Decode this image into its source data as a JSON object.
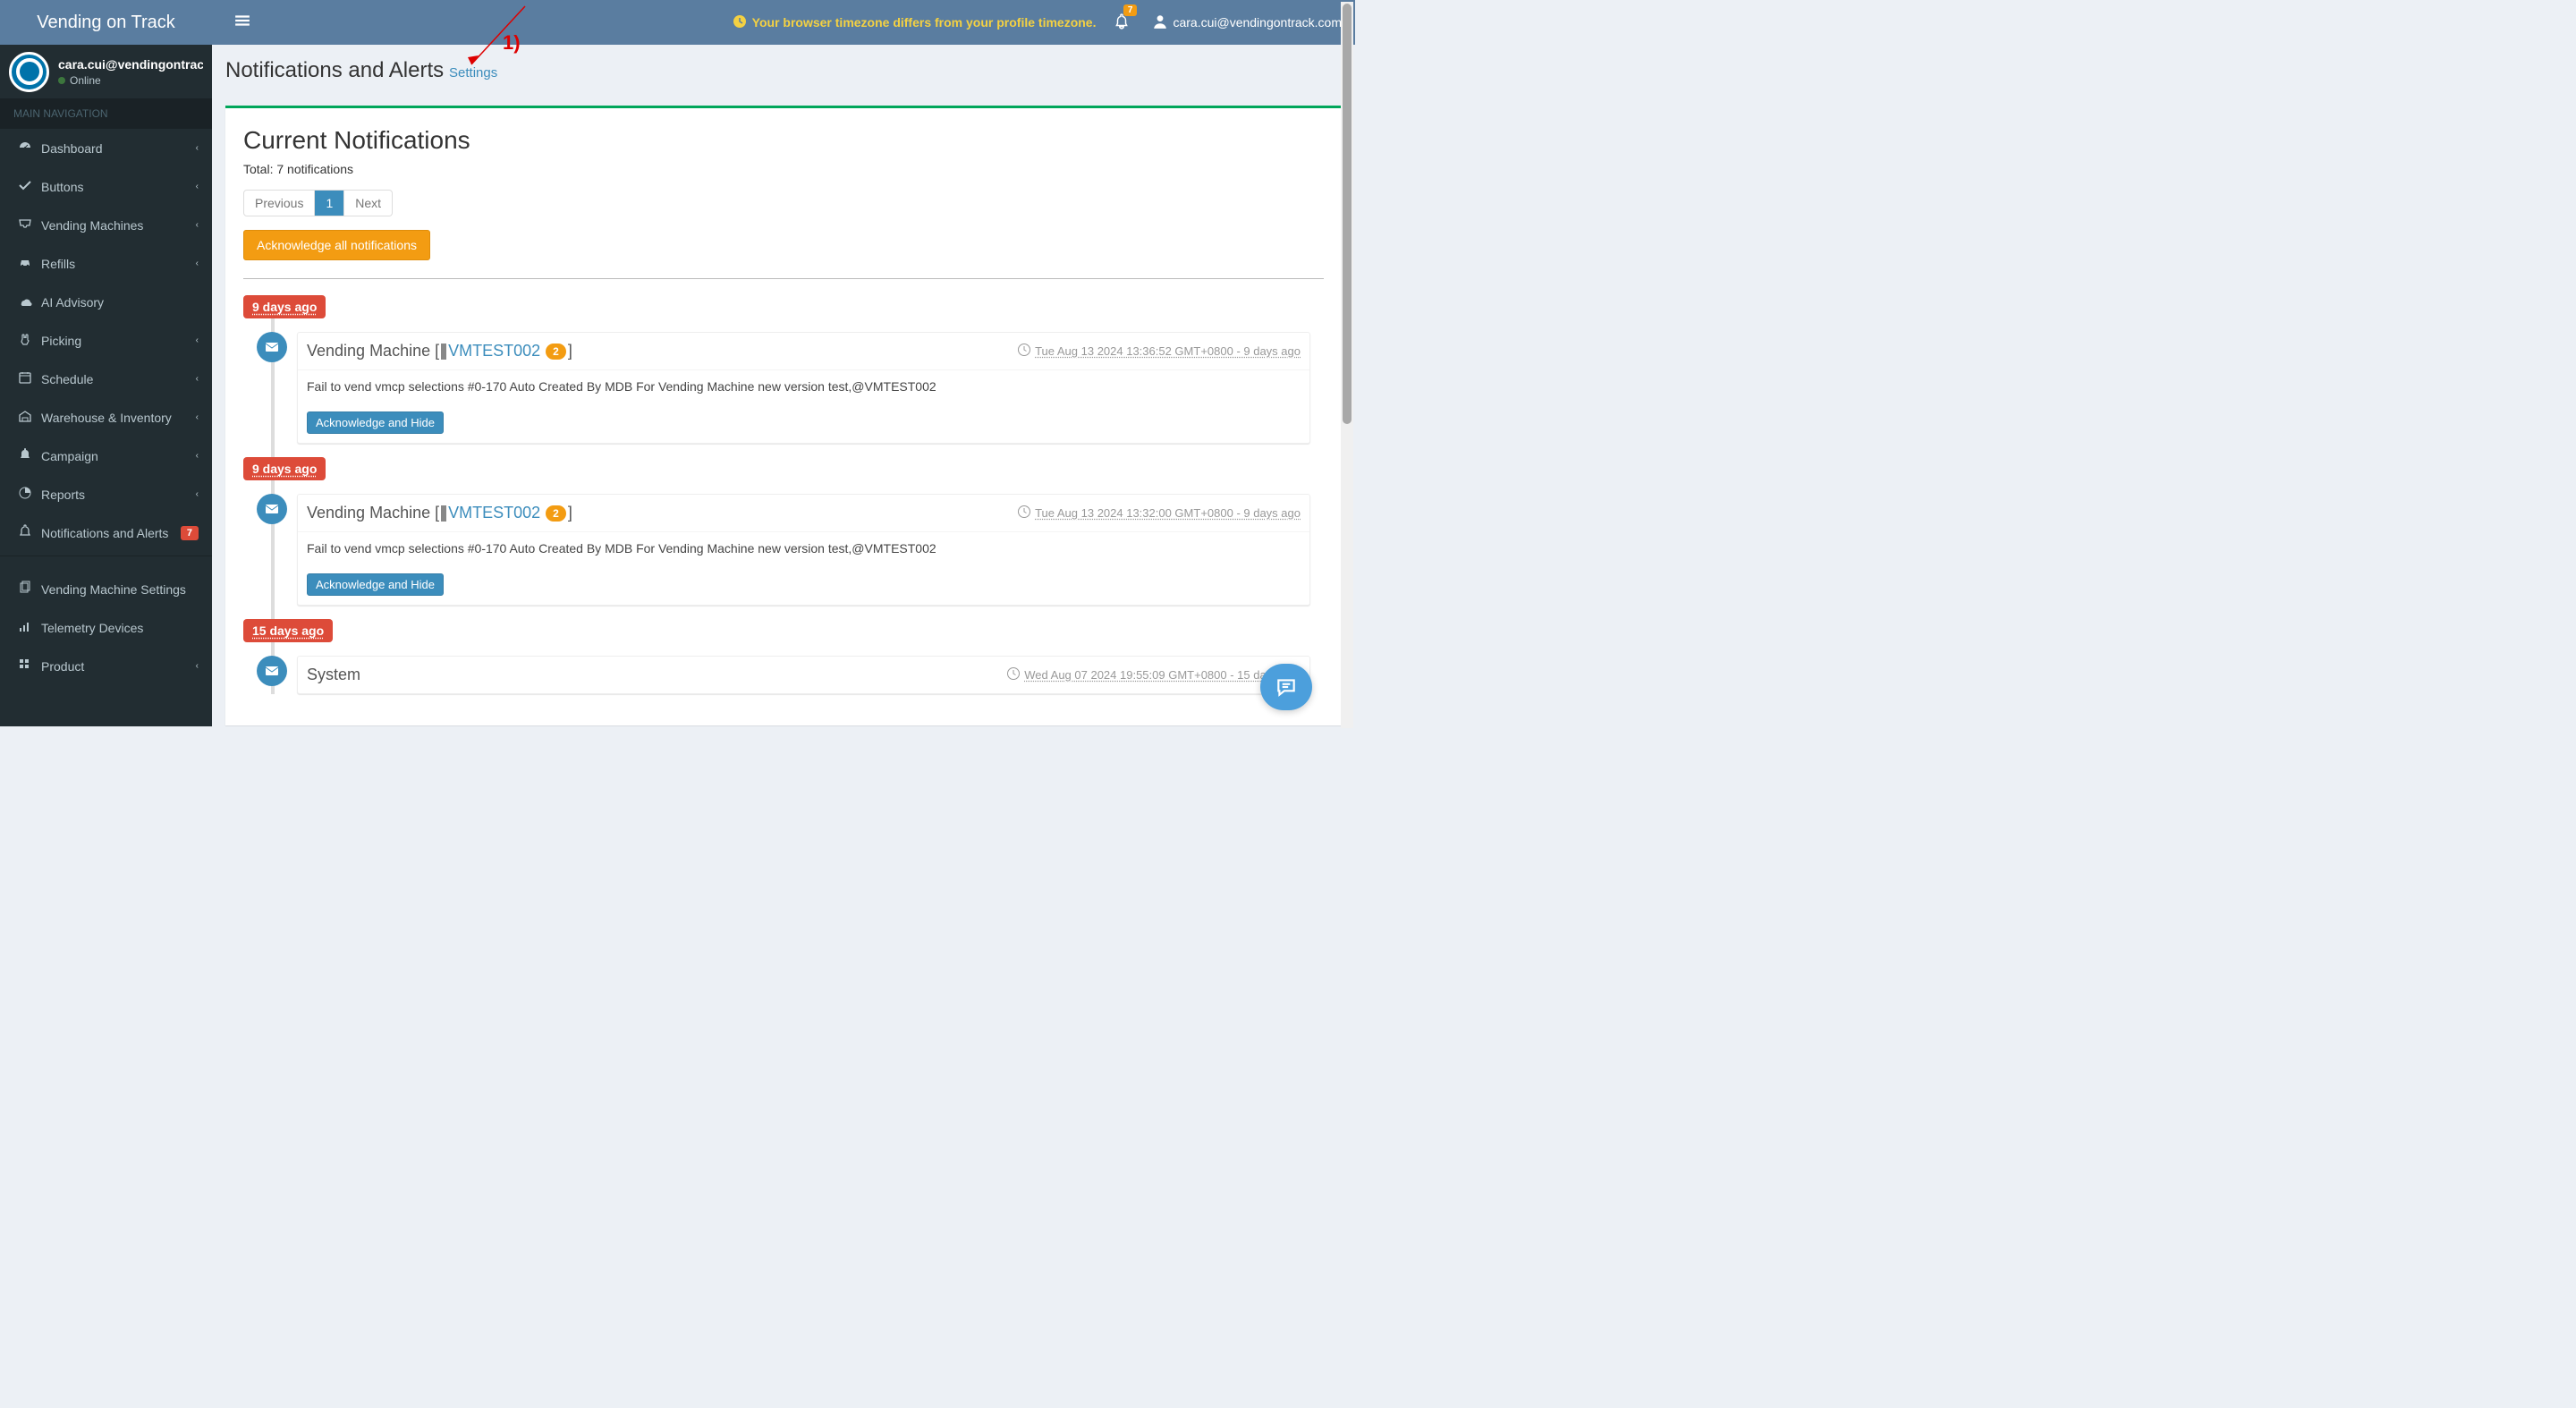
{
  "brand": "Vending on Track",
  "header": {
    "tz_warning": "Your browser timezone differs from your profile timezone.",
    "bell_badge": "7",
    "user_email": "cara.cui@vendingontrack.com"
  },
  "sidebar": {
    "user_email": "cara.cui@vendingontrack.c",
    "user_status": "Online",
    "nav_header": "MAIN NAVIGATION",
    "items": [
      {
        "label": "Dashboard",
        "icon": "dashboard",
        "chevron": true
      },
      {
        "label": "Buttons",
        "icon": "check",
        "chevron": true
      },
      {
        "label": "Vending Machines",
        "icon": "inbox",
        "chevron": true
      },
      {
        "label": "Refills",
        "icon": "car",
        "chevron": true
      },
      {
        "label": "AI Advisory",
        "icon": "cloud",
        "chevron": false
      },
      {
        "label": "Picking",
        "icon": "hand",
        "chevron": true
      },
      {
        "label": "Schedule",
        "icon": "calendar",
        "chevron": true
      },
      {
        "label": "Warehouse & Inventory",
        "icon": "warehouse",
        "chevron": true
      },
      {
        "label": "Campaign",
        "icon": "bell-fill",
        "chevron": true
      },
      {
        "label": "Reports",
        "icon": "pie",
        "chevron": true
      },
      {
        "label": "Notifications and Alerts",
        "icon": "bell",
        "chevron": false,
        "badge": "7"
      }
    ],
    "items2": [
      {
        "label": "Vending Machine Settings",
        "icon": "copy",
        "chevron": false
      },
      {
        "label": "Telemetry Devices",
        "icon": "signal",
        "chevron": false
      },
      {
        "label": "Product",
        "icon": "grid",
        "chevron": true
      }
    ]
  },
  "page": {
    "title": "Notifications and Alerts",
    "settings_link": "Settings",
    "annotation": "1)"
  },
  "main": {
    "heading": "Current Notifications",
    "total_prefix": "Total: ",
    "total_count": "7",
    "total_suffix": " notifications",
    "pagination": {
      "prev": "Previous",
      "page": "1",
      "next": "Next"
    },
    "ack_all": "Acknowledge all notifications",
    "ack_hide": "Acknowledge and Hide",
    "entries": [
      {
        "age": "9 days ago",
        "title_prefix": "Vending Machine [",
        "vm": "VMTEST002",
        "count": "2",
        "title_suffix": "]",
        "timestamp": "Tue Aug 13 2024 13:36:52 GMT+0800 - 9 days ago",
        "body": "Fail to vend vmcp selections #0-170 Auto Created By MDB For Vending Machine new version test,@VMTEST002"
      },
      {
        "age": "9 days ago",
        "title_prefix": "Vending Machine [",
        "vm": "VMTEST002",
        "count": "2",
        "title_suffix": "]",
        "timestamp": "Tue Aug 13 2024 13:32:00 GMT+0800 - 9 days ago",
        "body": "Fail to vend vmcp selections #0-170 Auto Created By MDB For Vending Machine new version test,@VMTEST002"
      },
      {
        "age": "15 days ago",
        "title_plain": "System",
        "timestamp": "Wed Aug 07 2024 19:55:09 GMT+0800 - 15 days ago"
      }
    ]
  }
}
